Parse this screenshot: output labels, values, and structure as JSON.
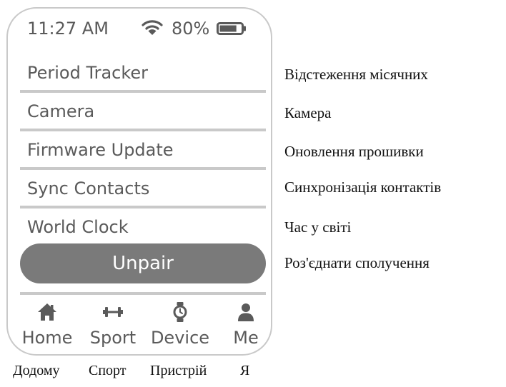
{
  "status_bar": {
    "time": "11:27 AM",
    "battery_percent": "80%",
    "battery_level": 0.8
  },
  "menu": {
    "items": [
      {
        "label": "Period Tracker",
        "translation": "Відстеження місячних"
      },
      {
        "label": "Camera",
        "translation": "Камера"
      },
      {
        "label": "Firmware Update",
        "translation": "Оновлення прошивки"
      },
      {
        "label": "Sync Contacts",
        "translation": "Синхронізація контактів"
      },
      {
        "label": "World Clock",
        "translation": "Час у світі"
      }
    ],
    "unpair_label": "Unpair",
    "unpair_translation": "Роз'єднати сполучення"
  },
  "bottom_nav": {
    "items": [
      {
        "label": "Home",
        "icon": "home-icon",
        "translation": "Додому"
      },
      {
        "label": "Sport",
        "icon": "dumbbell-icon",
        "translation": "Спорт"
      },
      {
        "label": "Device",
        "icon": "watch-icon",
        "translation": "Пристрій"
      },
      {
        "label": "Me",
        "icon": "person-icon",
        "translation": "Я"
      }
    ]
  },
  "colors": {
    "ui_gray": "#5a5a5a",
    "divider": "#c9c9c9",
    "button": "#7a7a7a"
  }
}
